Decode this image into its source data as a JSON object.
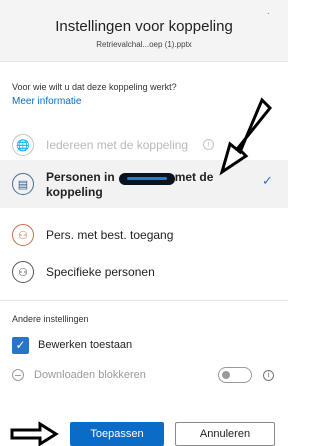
{
  "header": {
    "title": "Instellingen voor koppeling",
    "filename": "Retrievalchal...oep (1).pptx"
  },
  "question": "Voor wie wilt u dat deze koppeling werkt?",
  "more_info": "Meer informatie",
  "options": [
    {
      "label": "Iedereen met de koppeling",
      "icon": "globe-icon",
      "state": "disabled"
    },
    {
      "label_before": "Personen in",
      "label_after": "met de",
      "label_line2": "koppeling",
      "icon": "building-icon",
      "state": "selected"
    },
    {
      "label": "Pers. met best. toegang",
      "icon": "people-icon",
      "state": "normal"
    },
    {
      "label": "Specifieke personen",
      "icon": "people-icon",
      "state": "normal"
    }
  ],
  "other_settings": {
    "title": "Andere instellingen",
    "edit_label": "Bewerken toestaan",
    "edit_checked": true,
    "download_label": "Downloaden blokkeren",
    "download_enabled": false
  },
  "buttons": {
    "apply": "Toepassen",
    "cancel": "Annuleren"
  },
  "colors": {
    "accent": "#0b6cc7",
    "annotation_arrow": "#000000"
  }
}
